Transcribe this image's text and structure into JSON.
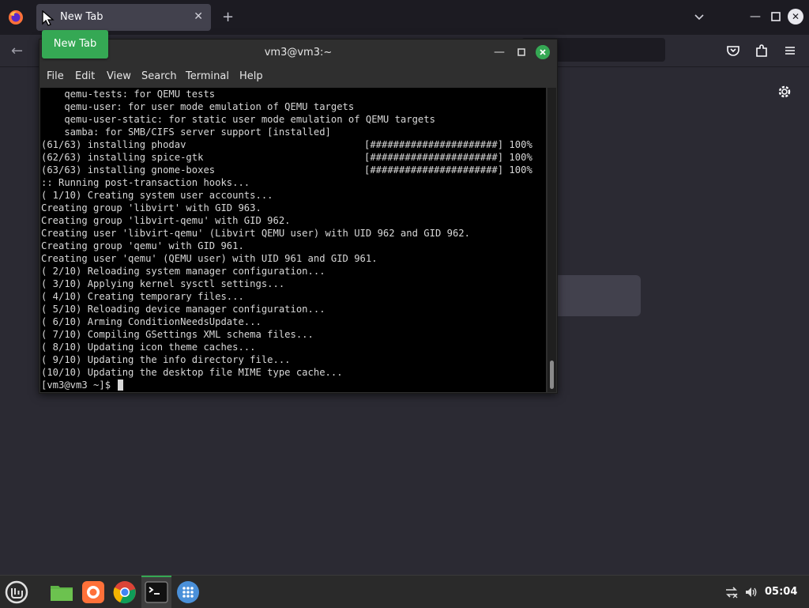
{
  "browser": {
    "tab_title": "New Tab",
    "tooltip": "New Tab"
  },
  "terminal": {
    "title": "vm3@vm3:~",
    "menu": [
      "File",
      "Edit",
      "View",
      "Search",
      "Terminal",
      "Help"
    ],
    "lines": [
      {
        "text": "    qemu-tests: for QEMU tests"
      },
      {
        "text": "    qemu-user: for user mode emulation of QEMU targets"
      },
      {
        "text": "    qemu-user-static: for static user mode emulation of QEMU targets"
      },
      {
        "text": "    samba: for SMB/CIFS server support [installed]"
      },
      {
        "text": "(61/63) installing phodav",
        "right": "[######################] 100%"
      },
      {
        "text": "(62/63) installing spice-gtk",
        "right": "[######################] 100%"
      },
      {
        "text": "(63/63) installing gnome-boxes",
        "right": "[######################] 100%"
      },
      {
        "text": ":: Running post-transaction hooks..."
      },
      {
        "text": "( 1/10) Creating system user accounts..."
      },
      {
        "text": "Creating group 'libvirt' with GID 963."
      },
      {
        "text": "Creating group 'libvirt-qemu' with GID 962."
      },
      {
        "text": "Creating user 'libvirt-qemu' (Libvirt QEMU user) with UID 962 and GID 962."
      },
      {
        "text": "Creating group 'qemu' with GID 961."
      },
      {
        "text": "Creating user 'qemu' (QEMU user) with UID 961 and GID 961."
      },
      {
        "text": "( 2/10) Reloading system manager configuration..."
      },
      {
        "text": "( 3/10) Applying kernel sysctl settings..."
      },
      {
        "text": "( 4/10) Creating temporary files..."
      },
      {
        "text": "( 5/10) Reloading device manager configuration..."
      },
      {
        "text": "( 6/10) Arming ConditionNeedsUpdate..."
      },
      {
        "text": "( 7/10) Compiling GSettings XML schema files..."
      },
      {
        "text": "( 8/10) Updating icon theme caches..."
      },
      {
        "text": "( 9/10) Updating the info directory file..."
      },
      {
        "text": "(10/10) Updating the desktop file MIME type cache..."
      }
    ],
    "prompt": "[vm3@vm3 ~]$ "
  },
  "taskbar": {
    "clock": "05:04"
  },
  "colors": {
    "accent": "#35a854",
    "terminal_bg": "#000000",
    "browser_bg": "#2b2a33"
  }
}
